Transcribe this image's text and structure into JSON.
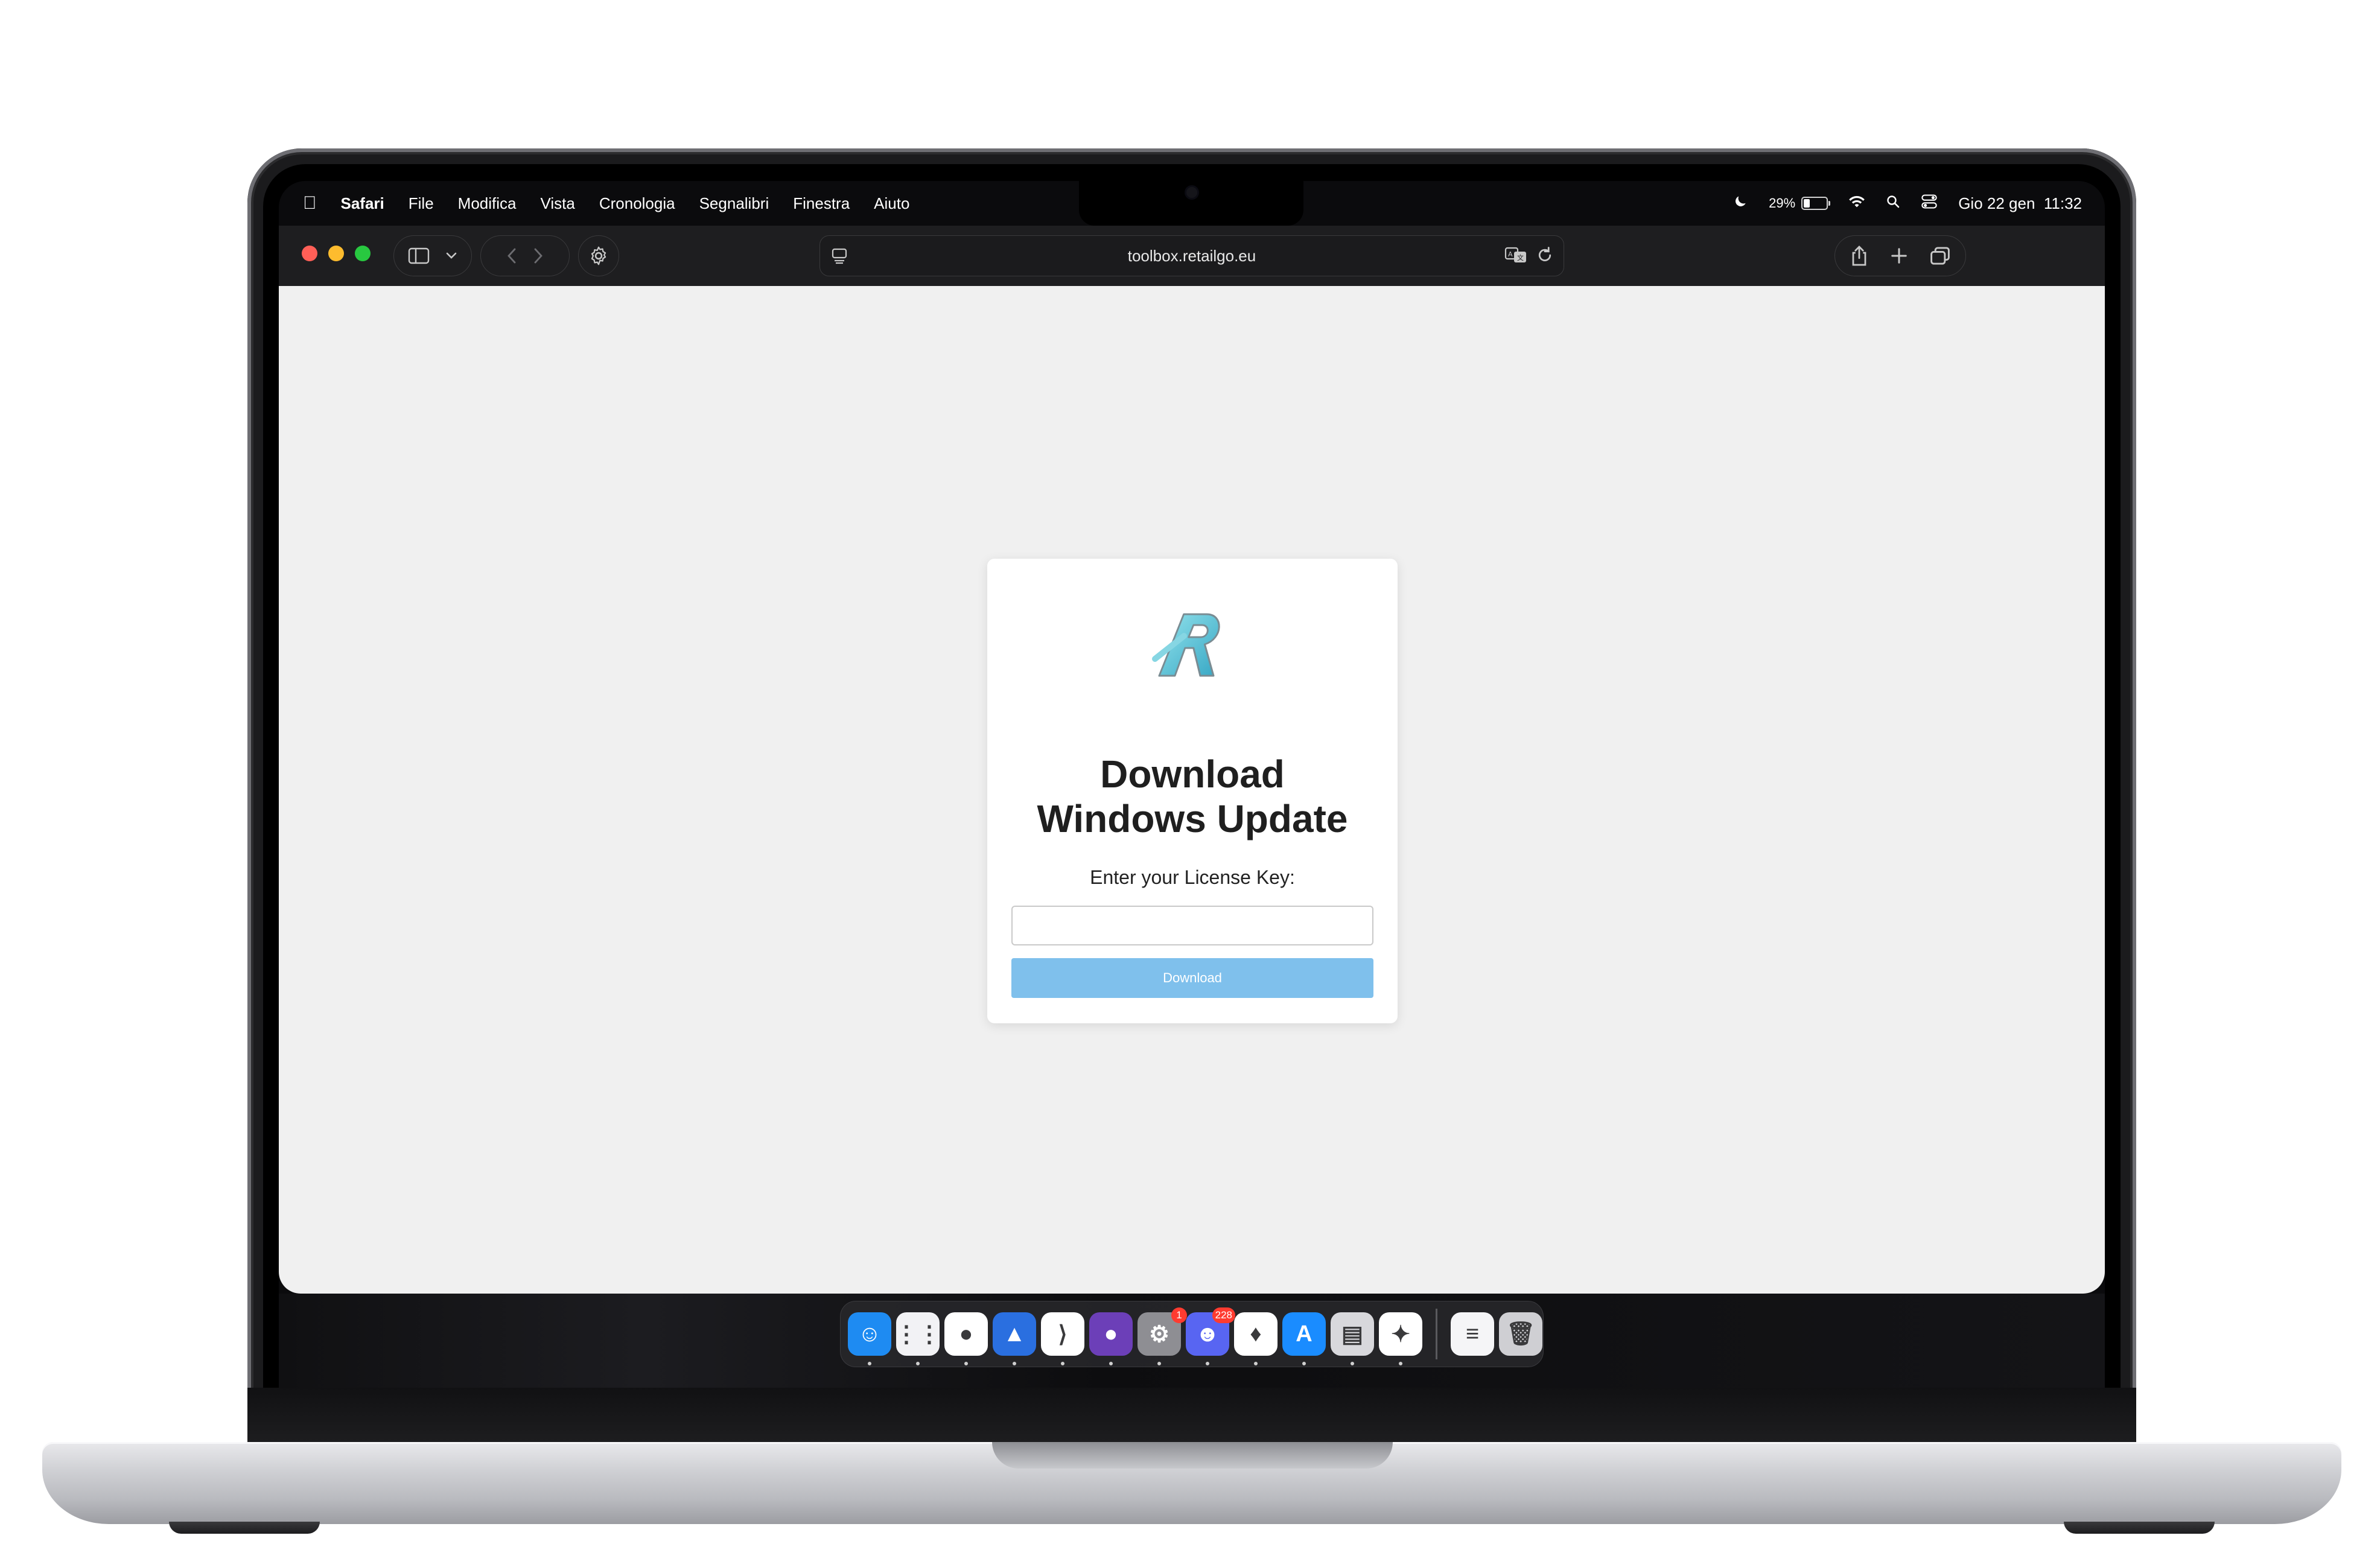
{
  "menubar": {
    "app_name": "Safari",
    "items": [
      "File",
      "Modifica",
      "Vista",
      "Cronologia",
      "Segnalibri",
      "Finestra",
      "Aiuto"
    ],
    "battery_percent": "29%",
    "battery_level": 0.29,
    "datetime": "Gio 22 gen  11:32"
  },
  "browser": {
    "url": "toolbox.retailgo.eu"
  },
  "page": {
    "title_line1": "Download",
    "title_line2": "Windows Update",
    "license_label": "Enter your License Key:",
    "license_value": "",
    "download_label": "Download",
    "colors": {
      "background": "#f0f0f0",
      "button": "#7fc0ec",
      "logo": "#5bc2d6"
    }
  },
  "dock": {
    "apps": [
      {
        "name": "finder-icon",
        "glyph": "☺",
        "color": "#1e8bf2"
      },
      {
        "name": "launchpad-icon",
        "glyph": "⋮⋮",
        "color": "#f2f2f5"
      },
      {
        "name": "chrome-icon",
        "glyph": "●",
        "color": "#ffffff"
      },
      {
        "name": "navigator-icon",
        "glyph": "▲",
        "color": "#2a6fe0"
      },
      {
        "name": "vscode-icon",
        "glyph": "⟩",
        "color": "#ffffff"
      },
      {
        "name": "github-icon",
        "glyph": "●",
        "color": "#6c3fb8"
      },
      {
        "name": "settings-icon",
        "glyph": "⚙",
        "color": "#8e8e93",
        "badge": "1"
      },
      {
        "name": "discord-icon",
        "glyph": "☻",
        "color": "#5865f2",
        "badge": "228"
      },
      {
        "name": "mongodb-icon",
        "glyph": "♦",
        "color": "#ffffff"
      },
      {
        "name": "app-store-icon",
        "glyph": "A",
        "color": "#1a8cff"
      },
      {
        "name": "preview-icon",
        "glyph": "▤",
        "color": "#d8d8dc"
      },
      {
        "name": "safari-icon",
        "glyph": "✦",
        "color": "#ffffff"
      }
    ],
    "extras": [
      {
        "name": "document-icon",
        "glyph": "≡",
        "color": "#f5f5f7"
      },
      {
        "name": "trash-icon",
        "glyph": "🗑",
        "color": "#cfcfd3"
      }
    ]
  }
}
